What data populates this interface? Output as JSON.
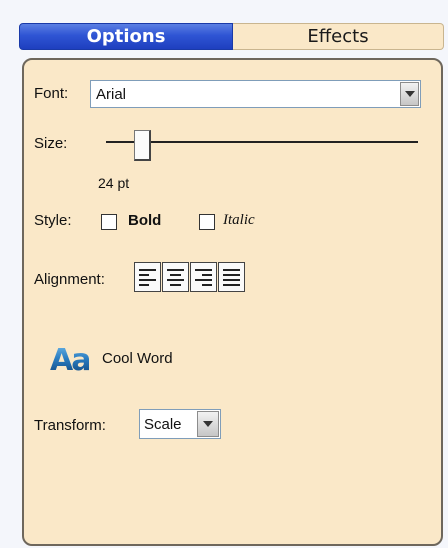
{
  "tabs": [
    {
      "label": "Options",
      "active": true
    },
    {
      "label": "Effects",
      "active": false
    }
  ],
  "colors": {
    "active_tab": "#2f55d4",
    "panel_bg": "#fae8c8"
  },
  "font": {
    "label": "Font:",
    "value": "Arial"
  },
  "size": {
    "label": "Size:",
    "value_text": "24 pt",
    "slider_fraction": 0.12
  },
  "style": {
    "label": "Style:",
    "bold_label": "Bold",
    "bold_checked": false,
    "italic_label": "Italic",
    "italic_checked": false
  },
  "alignment": {
    "label": "Alignment:",
    "buttons": [
      "align-left-icon",
      "align-center-icon",
      "align-right-icon",
      "align-justify-icon"
    ]
  },
  "preview": {
    "icon_text": "Aa",
    "label": "Cool Word"
  },
  "transform": {
    "label": "Transform:",
    "value": "Scale"
  }
}
